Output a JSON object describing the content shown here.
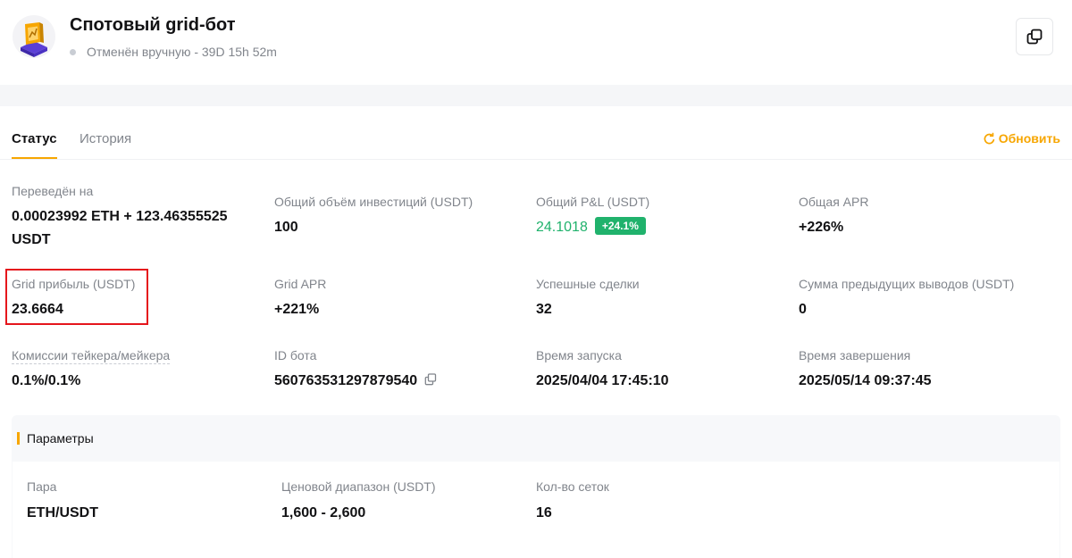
{
  "header": {
    "title": "Спотовый grid-бот",
    "status": "Отменён вручную - 39D 15h 52m"
  },
  "tabs": [
    {
      "label": "Статус",
      "active": true
    },
    {
      "label": "История",
      "active": false
    }
  ],
  "refresh_label": "Обновить",
  "stats": {
    "transferred": {
      "label": "Переведён на",
      "value_line1": "0.00023992 ETH + 123.46355525",
      "value_line2": "USDT"
    },
    "total_investment": {
      "label": "Общий объём инвестиций (USDT)",
      "value": "100"
    },
    "total_pnl": {
      "label": "Общий P&L (USDT)",
      "value": "24.1018",
      "badge": "+24.1%"
    },
    "total_apr": {
      "label": "Общая APR",
      "value": "+226%"
    },
    "grid_profit": {
      "label": "Grid прибыль (USDT)",
      "value": "23.6664"
    },
    "grid_apr": {
      "label": "Grid APR",
      "value": "+221%"
    },
    "successful_trades": {
      "label": "Успешные сделки",
      "value": "32"
    },
    "previous_withdrawals": {
      "label": "Сумма предыдущих выводов (USDT)",
      "value": "0"
    },
    "fees": {
      "label": "Комиссии тейкера/мейкера",
      "value": "0.1%/0.1%"
    },
    "bot_id": {
      "label": "ID бота",
      "value": "560763531297879540"
    },
    "start_time": {
      "label": "Время запуска",
      "value": "2025/04/04 17:45:10"
    },
    "end_time": {
      "label": "Время завершения",
      "value": "2025/05/14 09:37:45"
    }
  },
  "params": {
    "title": "Параметры",
    "pair": {
      "label": "Пара",
      "value": "ETH/USDT"
    },
    "price_range": {
      "label": "Ценовой диапазон (USDT)",
      "value": "1,600 - 2,600"
    },
    "grid_count": {
      "label": "Кол-во сеток",
      "value": "16"
    }
  },
  "colors": {
    "accent": "#f7a600",
    "positive": "#20b26c",
    "highlight_border": "#e5161c"
  }
}
